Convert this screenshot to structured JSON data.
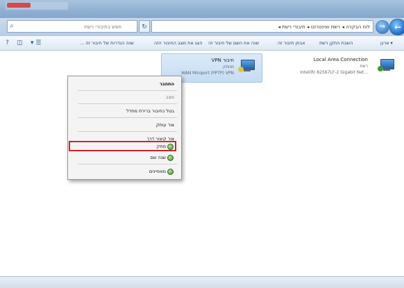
{
  "titlebar": {
    "title": ""
  },
  "address": {
    "path": "לוח הבקרה ◂ רשת ואינטרנט ◂ חיבורי רשת ◂",
    "search_placeholder": "חפש בחיבורי רשת",
    "back_glyph": "←",
    "forward_glyph": "→",
    "refresh_glyph": "↻",
    "dropdown_glyph": "▾",
    "search_glyph": "⌕"
  },
  "commandbar": {
    "organize": "▾ ארגן",
    "disable": "השבת התקן רשת",
    "diagnose": "אבחן חיבור זה",
    "rename": "שנה את השם של חיבור זה",
    "view_status": "הצג את מצב החיבור הזה",
    "change_settings": "שנה הגדרות של חיבור זה ...",
    "more_glyph": "»",
    "view_glyph": "▾ ☰",
    "pane_glyph": "◫",
    "help_glyph": "?"
  },
  "connections": [
    {
      "name": "Local Area Connection",
      "status": "רשת",
      "device": "Intel(R) 82567LF-2 Gigabit Net...",
      "icon": "network-connection-icon"
    },
    {
      "name": "חיבור VPN",
      "status": "מנותק",
      "device": "WAN Miniport (PPTP) ‏VPN",
      "icon": "vpn-connection-icon",
      "selected": true
    }
  ],
  "context_menu": {
    "items": [
      {
        "label": "התחבר",
        "bold": true,
        "disabled": false,
        "icon": ""
      },
      {
        "label": "מצב",
        "bold": false,
        "disabled": true,
        "icon": ""
      },
      {
        "label": "בטל כחיבור ברירת מחדל",
        "bold": false,
        "disabled": false,
        "icon": ""
      },
      {
        "label": "צור עותק",
        "bold": false,
        "disabled": false,
        "icon": ""
      },
      {
        "label": "צור קיצור דרך",
        "bold": false,
        "disabled": false,
        "icon": ""
      },
      {
        "label": "מחק",
        "bold": false,
        "disabled": false,
        "icon": "shield-icon"
      },
      {
        "label": "שנה שם",
        "bold": false,
        "disabled": false,
        "icon": "shield-icon"
      },
      {
        "label": "מאפיינים",
        "bold": false,
        "disabled": false,
        "icon": "shield-icon"
      }
    ]
  },
  "colors": {
    "highlight": "#d0232a",
    "selection": "#c5dcf4",
    "titlebar": "#8fb0d2"
  }
}
